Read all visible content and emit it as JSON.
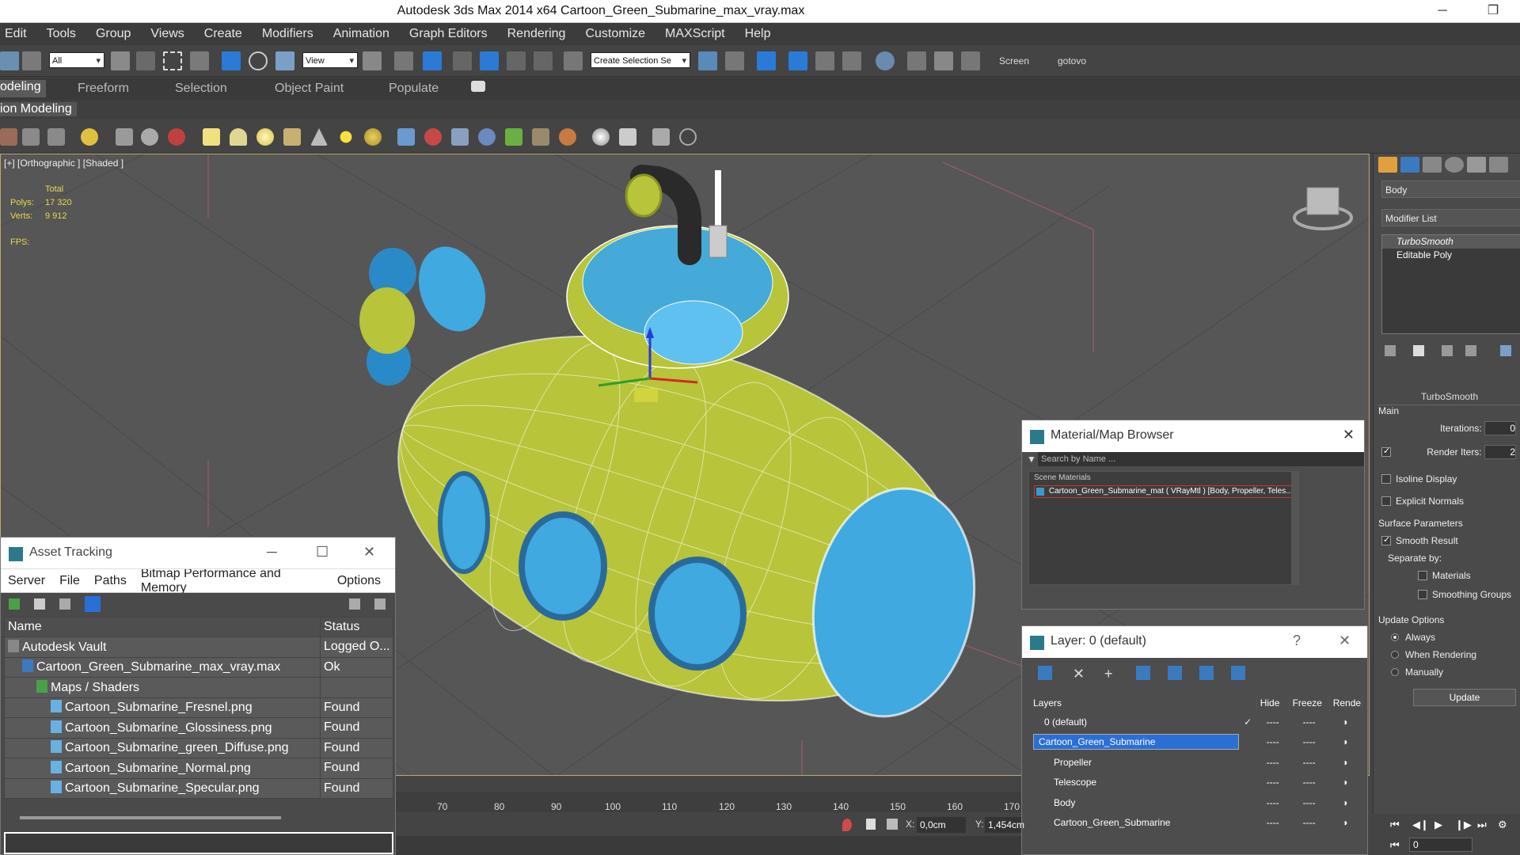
{
  "window": {
    "title": "Autodesk 3ds Max  2014 x64     Cartoon_Green_Submarine_max_vray.max",
    "minimize": "─",
    "maximize": "❐"
  },
  "menu": [
    "Edit",
    "Tools",
    "Group",
    "Views",
    "Create",
    "Modifiers",
    "Animation",
    "Graph Editors",
    "Rendering",
    "Customize",
    "MAXScript",
    "Help"
  ],
  "toolbar": {
    "filter_select": "All",
    "view_select": "View",
    "selection_set": "Create Selection Se",
    "screen_label": "Screen",
    "gotovo_label": "gotovo"
  },
  "ribbon": {
    "tabs": [
      "odeling",
      "Freeform",
      "Selection",
      "Object Paint",
      "Populate"
    ],
    "subtitle": "ion Modeling"
  },
  "viewport": {
    "label": "[+] [Orthographic ] [Shaded ]",
    "stats": {
      "total_label": "Total",
      "polys_label": "Polys:",
      "polys": "17 320",
      "verts_label": "Verts:",
      "verts": "9 912",
      "fps_label": "FPS:"
    }
  },
  "asset_tracking": {
    "title": "Asset Tracking",
    "menu": [
      "Server",
      "File",
      "Paths",
      "Bitmap Performance and Memory",
      "Options"
    ],
    "columns": [
      "Name",
      "Status"
    ],
    "rows": [
      {
        "name": "Autodesk Vault",
        "status": "Logged O...",
        "indent": 1
      },
      {
        "name": "Cartoon_Green_Submarine_max_vray.max",
        "status": "Ok",
        "indent": 2
      },
      {
        "name": "Maps / Shaders",
        "status": "",
        "indent": 3
      },
      {
        "name": "Cartoon_Submarine_Fresnel.png",
        "status": "Found",
        "indent": 4
      },
      {
        "name": "Cartoon_Submarine_Glossiness.png",
        "status": "Found",
        "indent": 4
      },
      {
        "name": "Cartoon_Submarine_green_Diffuse.png",
        "status": "Found",
        "indent": 4
      },
      {
        "name": "Cartoon_Submarine_Normal.png",
        "status": "Found",
        "indent": 4
      },
      {
        "name": "Cartoon_Submarine_Specular.png",
        "status": "Found",
        "indent": 4
      }
    ]
  },
  "material_browser": {
    "title": "Material/Map Browser",
    "search_placeholder": "Search by Name ...",
    "category": "Scene Materials",
    "item": "Cartoon_Green_Submarine_mat  ( VRayMtl ) [Body, Propeller, Teles..."
  },
  "layer_manager": {
    "title": "Layer: 0 (default)",
    "help": "?",
    "columns": [
      "Layers",
      "Hide",
      "Freeze",
      "Rende"
    ],
    "rows": [
      {
        "name": "0 (default)",
        "checked": true
      },
      {
        "name": "Cartoon_Green_Submarine",
        "selected": true
      },
      {
        "name": "Propeller"
      },
      {
        "name": "Telescope"
      },
      {
        "name": "Body"
      },
      {
        "name": "Cartoon_Green_Submarine"
      }
    ],
    "dash": "----"
  },
  "command_panel": {
    "object_name": "Body",
    "modifier_list": "Modifier List",
    "stack": [
      "TurboSmooth",
      "Editable Poly"
    ],
    "turbosmooth": {
      "title": "TurboSmooth",
      "main": "Main",
      "iterations_label": "Iterations:",
      "iterations": "0",
      "render_iters_label": "Render Iters:",
      "render_iters": "2",
      "isoline": "Isoline Display",
      "explicit": "Explicit Normals",
      "surface_params": "Surface Parameters",
      "smooth_result": "Smooth Result",
      "separate_by": "Separate by:",
      "materials": "Materials",
      "smoothing_groups": "Smoothing Groups",
      "update_options": "Update Options",
      "always": "Always",
      "when_rendering": "When Rendering",
      "manually": "Manually",
      "update": "Update"
    }
  },
  "timeline": {
    "ticks": [
      "70",
      "80",
      "90",
      "100",
      "110",
      "120",
      "130",
      "140",
      "150",
      "160",
      "170"
    ]
  },
  "status": {
    "x_label": "X:",
    "x_value": "0,0cm",
    "y_label": "Y:",
    "y_value": "1,454cm"
  },
  "anim": {
    "frame": "0"
  },
  "colors": {
    "viewport_bg": "#565656",
    "hull": "#b8c43a",
    "glass": "#3fa9e0",
    "selection": "#2a6fd6"
  }
}
